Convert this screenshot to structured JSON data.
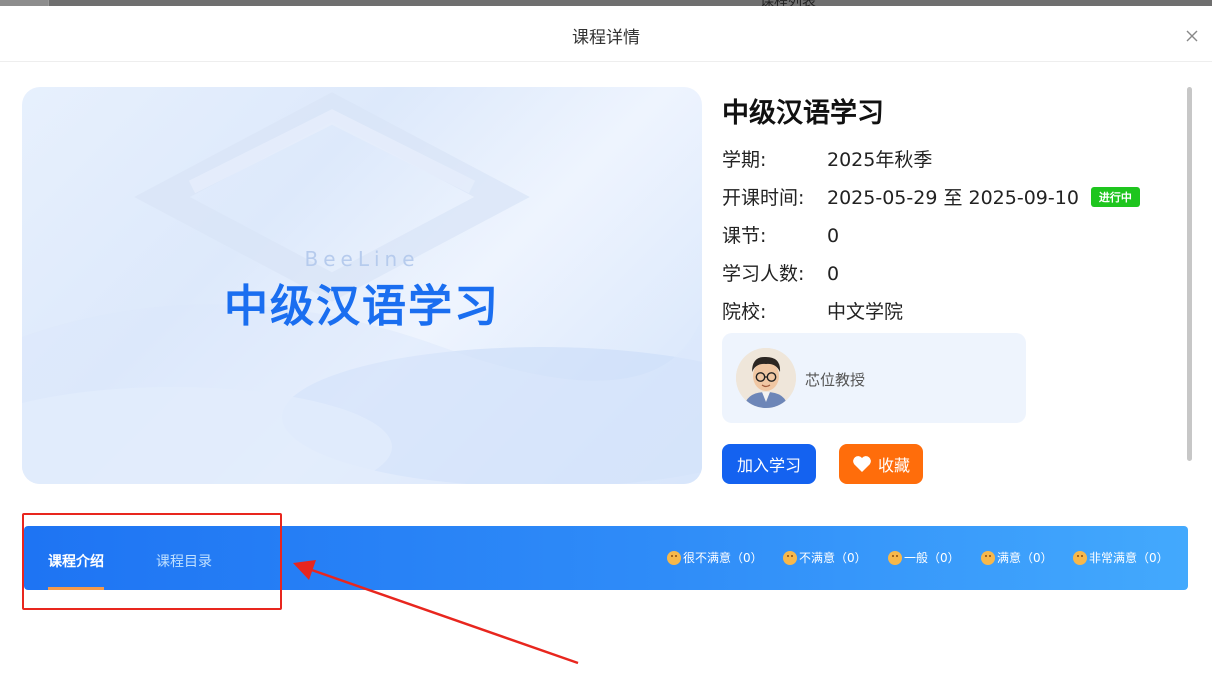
{
  "background_page": {
    "title": "课程列表"
  },
  "modal": {
    "title": "课程详情",
    "close_icon": "close-icon"
  },
  "cover": {
    "brand": "BeeLine",
    "title": "中级汉语学习"
  },
  "course": {
    "title": "中级汉语学习",
    "fields": {
      "term_label": "学期:",
      "term_value": "2025年秋季",
      "time_label": "开课时间:",
      "time_value": "2025-05-29 至 2025-09-10",
      "status": "进行中",
      "lessons_label": "课节:",
      "lessons_value": "0",
      "learners_label": "学习人数:",
      "learners_value": "0",
      "school_label": "院校:",
      "school_value": "中文学院"
    },
    "teacher": {
      "name": "芯位教授",
      "avatar_icon": "teacher-avatar"
    },
    "actions": {
      "join": "加入学习",
      "favorite": "收藏",
      "favorite_icon": "heart-icon"
    }
  },
  "tabs": [
    {
      "label": "课程介绍",
      "active": true
    },
    {
      "label": "课程目录",
      "active": false
    }
  ],
  "ratings": [
    {
      "label": "很不满意（0）",
      "icon": "very-dissatisfied-face-icon"
    },
    {
      "label": "不满意（0）",
      "icon": "dissatisfied-face-icon"
    },
    {
      "label": "一般（0）",
      "icon": "neutral-face-icon"
    },
    {
      "label": "满意（0）",
      "icon": "satisfied-face-icon"
    },
    {
      "label": "非常满意（0）",
      "icon": "very-satisfied-face-icon"
    }
  ],
  "colors": {
    "primary": "#1462f0",
    "favorite": "#ff6d0b",
    "status": "#1ec51e",
    "tab_active_underline": "#f59a4a",
    "annotation": "#e8261e"
  }
}
